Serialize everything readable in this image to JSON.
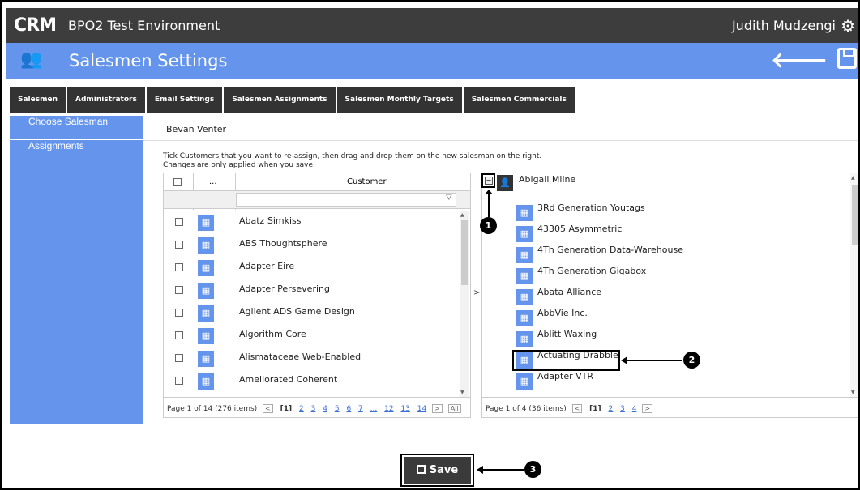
{
  "app": {
    "logo": "CRM",
    "environment": "BPO2 Test Environment",
    "user": "Judith Mudzengi"
  },
  "header": {
    "title": "Salesmen Settings"
  },
  "tabs": [
    {
      "label": "Salesmen"
    },
    {
      "label": "Administrators"
    },
    {
      "label": "Email Settings"
    },
    {
      "label": "Salesmen Assignments"
    },
    {
      "label": "Salesmen Monthly Targets"
    },
    {
      "label": "Salesmen Commercials"
    }
  ],
  "sidebar": {
    "items": [
      {
        "label": "Choose Salesman"
      },
      {
        "label": "Assignments"
      }
    ]
  },
  "selected_salesman": "Bevan Venter",
  "instructions": {
    "line1": "Tick Customers that you want to re-assign, then drag and drop them on the new salesman on the right.",
    "line2": "Changes are only applied when you save."
  },
  "left_grid": {
    "header_dots": "...",
    "header_customer": "Customer",
    "rows": [
      {
        "name": "Abatz Simkiss"
      },
      {
        "name": "ABS Thoughtsphere"
      },
      {
        "name": "Adapter Eire"
      },
      {
        "name": "Adapter Persevering"
      },
      {
        "name": "Agilent ADS Game Design"
      },
      {
        "name": "Algorithm Core"
      },
      {
        "name": "Alismataceae Web-Enabled"
      },
      {
        "name": "Ameliorated Coherent"
      }
    ],
    "pager": {
      "summary": "Page 1 of 14 (276 items)",
      "current": "[1]",
      "pages": [
        "2",
        "3",
        "4",
        "5",
        "6",
        "7",
        "...",
        "12",
        "13",
        "14"
      ],
      "all": "All"
    }
  },
  "mover": {
    "label": ">"
  },
  "right_panel": {
    "salesman": "Abigail Milne",
    "items": [
      {
        "name": "3Rd Generation Youtags"
      },
      {
        "name": "43305 Asymmetric"
      },
      {
        "name": "4Th Generation Data-Warehouse"
      },
      {
        "name": "4Th Generation Gigabox"
      },
      {
        "name": "Abata Alliance"
      },
      {
        "name": "AbbVie Inc."
      },
      {
        "name": "Ablitt Waxing"
      },
      {
        "name": "Actuating Drabble"
      },
      {
        "name": "Adapter VTR"
      }
    ],
    "pager": {
      "summary": "Page 1 of 4 (36 items)",
      "current": "[1]",
      "pages": [
        "2",
        "3",
        "4"
      ]
    }
  },
  "callouts": [
    "1",
    "2",
    "3"
  ],
  "save": {
    "label": "Save"
  },
  "colors": {
    "accent": "#6494ec",
    "dark": "#3d3d3d"
  },
  "icons": {
    "settings": "gear-icon",
    "back": "back-arrow-icon",
    "save": "floppy-disk-icon",
    "customer": "building-icon",
    "user": "user-icon"
  }
}
